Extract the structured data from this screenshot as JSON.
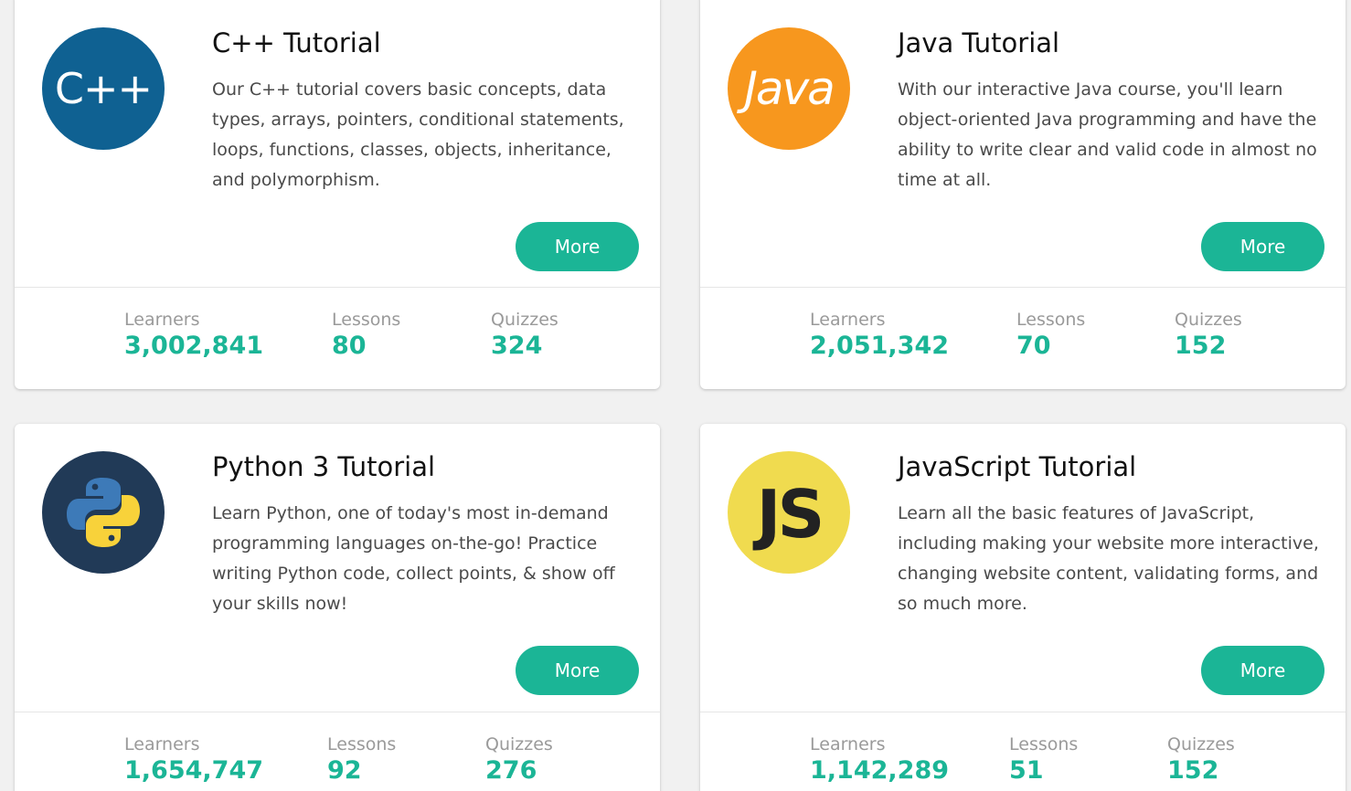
{
  "cards": [
    {
      "title": "C++ Tutorial",
      "logo_text": "C++",
      "logo_color": "#0f6192",
      "description": "Our C++ tutorial covers basic concepts, data types, arrays, pointers, conditional statements, loops, functions, classes, objects, inheritance, and polymorphism.",
      "button": "More",
      "learners_label": "Learners",
      "learners": "3,002,841",
      "lessons_label": "Lessons",
      "lessons": "80",
      "quizzes_label": "Quizzes",
      "quizzes": "324"
    },
    {
      "title": "Java Tutorial",
      "logo_text": "Java",
      "logo_color": "#f7971e",
      "description": "With our interactive Java course, you'll learn object-oriented Java programming and have the ability to write clear and valid code in almost no time at all.",
      "button": "More",
      "learners_label": "Learners",
      "learners": "2,051,342",
      "lessons_label": "Lessons",
      "lessons": "70",
      "quizzes_label": "Quizzes",
      "quizzes": "152"
    },
    {
      "title": "Python 3 Tutorial",
      "logo_icon": "python-logo-icon",
      "logo_color": "#213a57",
      "description": "Learn Python, one of today's most in-demand programming languages on-the-go! Practice writing Python code, collect points, & show off your skills now!",
      "button": "More",
      "learners_label": "Learners",
      "learners": "1,654,747",
      "lessons_label": "Lessons",
      "lessons": "92",
      "quizzes_label": "Quizzes",
      "quizzes": "276"
    },
    {
      "title": "JavaScript Tutorial",
      "logo_text": "JS",
      "logo_color": "#f0db4f",
      "description": "Learn all the basic features of JavaScript, including making your website more interactive, changing website content, validating forms, and so much more.",
      "button": "More",
      "learners_label": "Learners",
      "learners": "1,142,289",
      "lessons_label": "Lessons",
      "lessons": "51",
      "quizzes_label": "Quizzes",
      "quizzes": "152"
    }
  ],
  "accent_color": "#1bb596"
}
